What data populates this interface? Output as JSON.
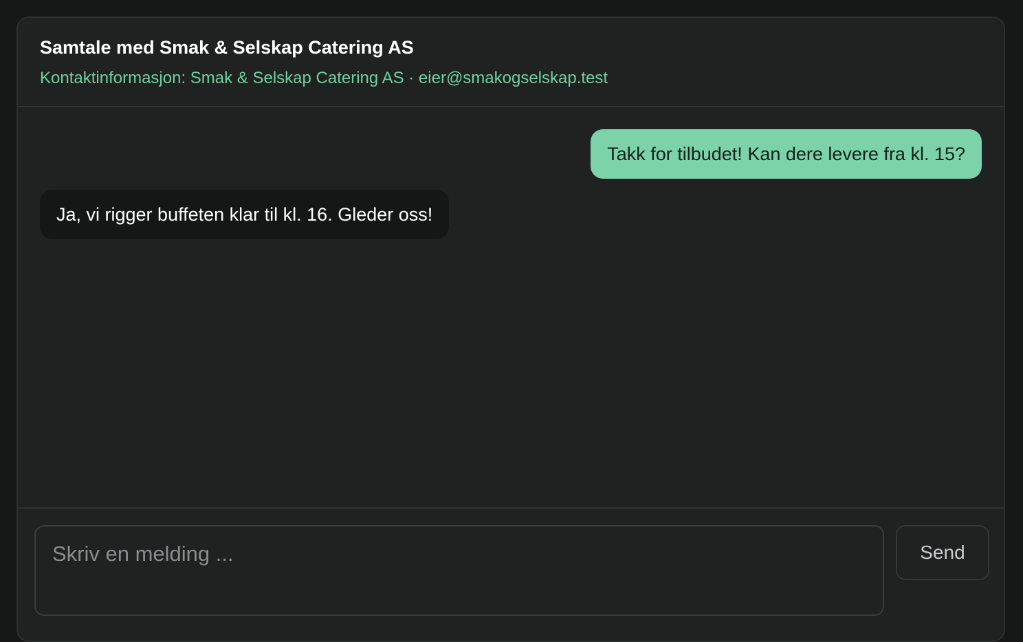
{
  "header": {
    "title": "Samtale med Smak & Selskap Catering AS",
    "contact": "Kontaktinformasjon: Smak & Selskap Catering AS · eier@smakogselskap.test"
  },
  "messages": [
    {
      "direction": "outgoing",
      "text": "Takk for tilbudet! Kan dere levere fra kl. 15?"
    },
    {
      "direction": "incoming",
      "text": "Ja, vi rigger buffeten klar til kl. 16. Gleder oss!"
    }
  ],
  "composer": {
    "placeholder": "Skriv en melding ...",
    "value": "",
    "send_label": "Send"
  },
  "colors": {
    "page_background": "#161818",
    "card_background": "#202222",
    "accent": "#6fd0a0",
    "outgoing_bubble": "#7cd2a9",
    "incoming_bubble": "#151616"
  }
}
